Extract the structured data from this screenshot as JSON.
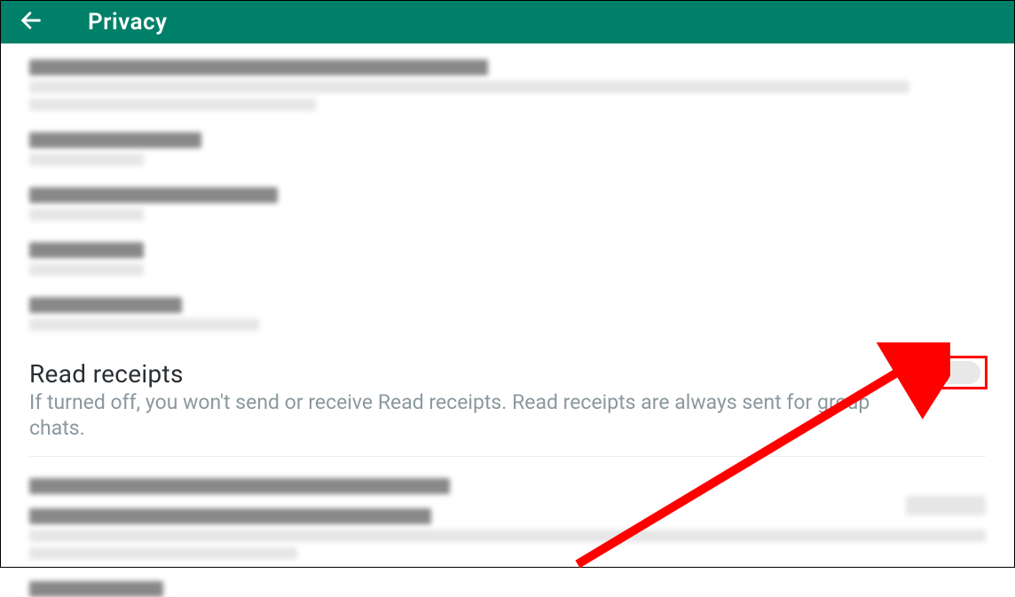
{
  "header": {
    "title": "Privacy"
  },
  "settings": {
    "read_receipts": {
      "title": "Read receipts",
      "description": "If turned off, you won't send or receive Read receipts. Read receipts are always sent for group chats.",
      "enabled": false
    }
  },
  "annotations": {
    "highlight_color": "#ff0000"
  }
}
